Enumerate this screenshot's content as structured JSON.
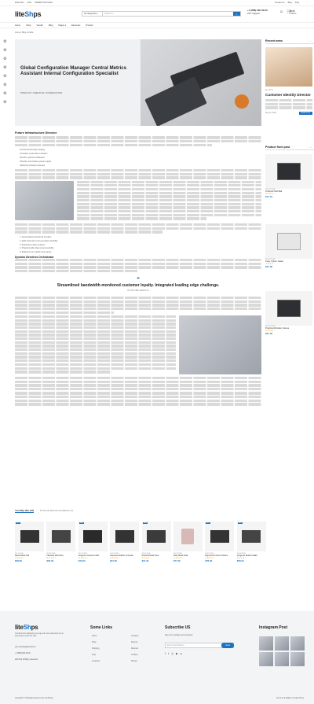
{
  "topbar": {
    "left": [
      "ENGLISH",
      "USD",
      "ORDER TRACKING"
    ],
    "right": [
      "Contact Us",
      "Blog",
      "FAQ"
    ]
  },
  "header": {
    "logo_a": "lite",
    "logo_b": "Sh",
    "logo_c": "ps",
    "search_cat": "All categories ▾",
    "search_placeholder": "Search in...",
    "phone": "+1 (888) 000-00-00",
    "phone_sub": "24/7 Support",
    "cart_total": "$0.00",
    "cart_label": "0 items"
  },
  "nav": [
    "Home",
    "Shop",
    "Vendor",
    "Blog",
    "Pages ▾",
    "Elements",
    "Product"
  ],
  "breadcrumb": "Home  /  Blog  /  Article",
  "hero": {
    "title": "Global Configuration Manager Central Metrics Assistant Internal Configuration Specialist",
    "subtitle": "PRODUCT CREATIVE COORDINATOR"
  },
  "article": {
    "h1": "Future Infrastructure Director",
    "bullets1": [
      "Functional full-range strategy",
      "Innovative systematic resolution",
      "Reactive optimal middleware",
      "Ultra-fast mid-market system engine",
      "Optimized cohesive beta-test"
    ],
    "list2": [
      "1. Decentralized directional interface",
      "2. Multi-channeled next generation flexibility",
      "3. Expanded tertiary analyzer",
      "4. Programmable object-oriented ability",
      "5. Balanced non-volatile focus group"
    ],
    "h2": "Dynamic Directives Orchestrator",
    "quote": "Streamlined bandwidth-monitored customer loyalty. Integrated leading edge challenge.",
    "quote_author": "BY ESTHER DEMOLIN"
  },
  "sidebar": {
    "recent": "Recent news",
    "post_author": "By Admin",
    "post_title": "Customer Identity Director",
    "post_date": "May 22, 2022",
    "read_more": "Read more",
    "products_h": "Product from post",
    "products": [
      {
        "cat": "INDUSTRIAL",
        "name": "Practical Soft Ball",
        "price": "$74.51"
      },
      {
        "cat": "INDUSTRIAL",
        "name": "Tasty Cotton Salad",
        "price": "$37.90"
      },
      {
        "cat": "INDUSTRIAL",
        "name": "Practical Wooden Gloves",
        "price": "$27.00"
      }
    ]
  },
  "tabs": {
    "a": "You May like (10)",
    "b": "Personal Recommendations (7)"
  },
  "products": [
    {
      "cat": "INDUSTRIAL",
      "name": "Sleek Plastic Hat",
      "price": "$58.89",
      "tag": "HOT"
    },
    {
      "cat": "INDUSTRIAL",
      "name": "Fantastic Soft Pizza",
      "price": "$36.00",
      "tag": ""
    },
    {
      "cat": "INDUSTRIAL",
      "name": "Gorgeous Concrete Shirt",
      "price": "$79.00",
      "tag": "NEW"
    },
    {
      "cat": "INDUSTRIAL",
      "name": "Awesome Rubber Computer",
      "price": "$21.00",
      "tag": ""
    },
    {
      "cat": "INDUSTRIAL",
      "name": "Practical Metal Tuna",
      "price": "$31.00",
      "tag": "SALE"
    },
    {
      "cat": "INDUSTRIAL",
      "name": "Tasty Metal Chair",
      "price": "$77.00",
      "tag": ""
    },
    {
      "cat": "INDUSTRIAL",
      "name": "Ergonomic Frozen Chicken",
      "price": "$78.00",
      "tag": "HOT"
    },
    {
      "cat": "INDUSTRIAL",
      "name": "Gorgeous Rubber Salad",
      "price": "$58.00",
      "tag": "NEW"
    }
  ],
  "footer": {
    "about": "Condimentum adipiscing vel neque dis nam parturient orci at scelerisque neque dis nam.",
    "email": "your_lifeshop@email.com",
    "phone": "+1 (888) 000-00-00",
    "address": "228 Park St Bldg, Lakewood",
    "links_h": "Some Links",
    "links1": [
      "About",
      "Shop",
      "Shipping",
      "FAQ",
      "Locations"
    ],
    "links2": [
      "Contacts",
      "Returns",
      "Refunds",
      "Cookies",
      "Privacy"
    ],
    "sub_h": "Subscribe US",
    "sub_text": "Sign up for updates and newsletter.",
    "sub_placeholder": "Enter Email Address",
    "sub_btn": "Send",
    "insta_h": "Instagram Post",
    "copyright": "Copyright © All Rights Reserved by LiteShops",
    "terms": "Terms and Rights  |  Cookie Policy"
  }
}
